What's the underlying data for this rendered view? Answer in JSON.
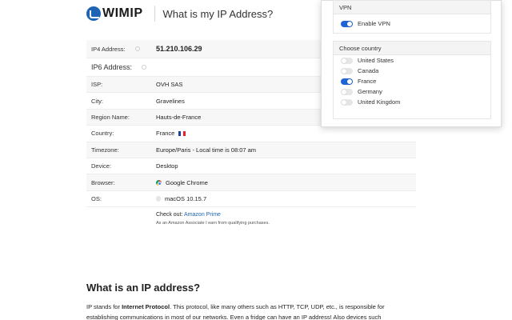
{
  "header": {
    "logo_text": "WIMIP",
    "title": "What is my IP Address?"
  },
  "info": {
    "rows": [
      {
        "label": "IP4 Address:",
        "value": "51.210.106.29"
      },
      {
        "label": "IP6 Address:",
        "value": ""
      },
      {
        "label": "ISP:",
        "value": "OVH SAS"
      },
      {
        "label": "City:",
        "value": "Gravelines"
      },
      {
        "label": "Region Name:",
        "value": "Hauts-de-France"
      },
      {
        "label": "Country:",
        "value": "France"
      },
      {
        "label": "Timezone:",
        "value": "Europe/Paris - Local time is 08:07 am"
      },
      {
        "label": "Device:",
        "value": "Desktop"
      },
      {
        "label": "Browser:",
        "value": "Google Chrome"
      },
      {
        "label": "OS:",
        "value": "macOS 10.15.7"
      }
    ]
  },
  "checkout": {
    "prefix": "Check out: ",
    "link": "Amazon Prime",
    "disclaimer": "As an Amazon Associate I earn from qualifying purchases."
  },
  "article": {
    "heading": "What is an IP address?",
    "p1_a": "IP stands for ",
    "p1_bold": "Internet Protocol",
    "p1_b": ". This protocol, like many others such as HTTP, TCP, UDP, etc., is responsible for establishing communications in most of our networks. Even a fridge can have an IP address! Also devices such"
  },
  "vpn": {
    "section_title": "VPN",
    "enable_label": "Enable VPN",
    "enabled": true,
    "country_title": "Choose country",
    "countries": [
      {
        "name": "United States",
        "selected": false
      },
      {
        "name": "Canada",
        "selected": false
      },
      {
        "name": "France",
        "selected": true
      },
      {
        "name": "Germany",
        "selected": false
      },
      {
        "name": "United Kingdom",
        "selected": false
      }
    ],
    "accent_color": "#1f64d4"
  }
}
